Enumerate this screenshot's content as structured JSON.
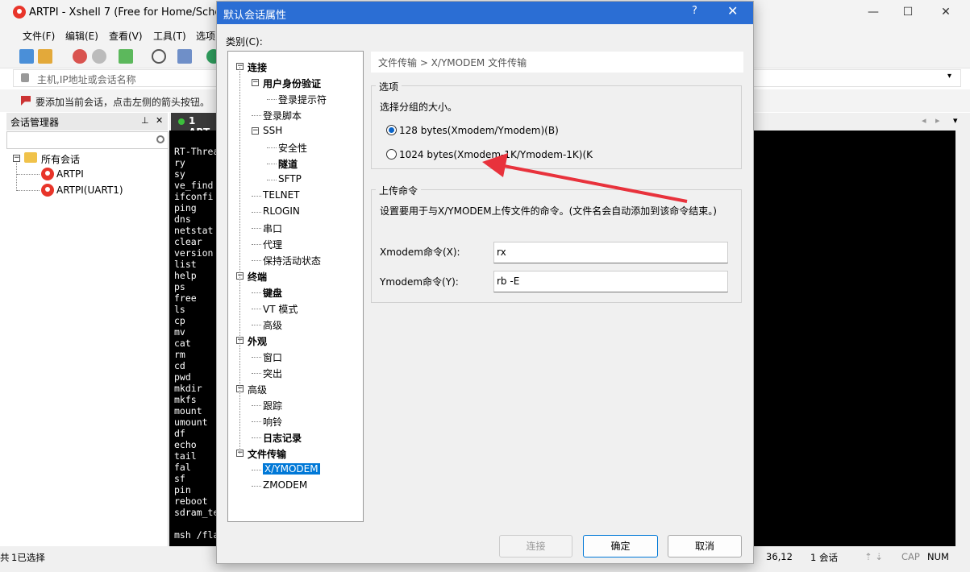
{
  "app": {
    "title": "ARTPI - Xshell 7 (Free for Home/School)"
  },
  "window_controls": {
    "minimize": "—",
    "maximize": "☐",
    "close": "✕"
  },
  "menubar": [
    {
      "label": "文件(F)"
    },
    {
      "label": "编辑(E)"
    },
    {
      "label": "查看(V)"
    },
    {
      "label": "工具(T)"
    },
    {
      "label": "选项"
    }
  ],
  "address": {
    "placeholder": "主机,IP地址或会话名称"
  },
  "tip": {
    "text": "要添加当前会话，点击左侧的箭头按钮。"
  },
  "session_manager": {
    "title": "会话管理器",
    "pin": "⊥",
    "close": "✕",
    "root": "所有会话",
    "items": [
      "ARTPI",
      "ARTPI(UART1)"
    ]
  },
  "terminal": {
    "tab_label": "1 ART",
    "lines": [
      "RT-Threa",
      "ry",
      "sy",
      "ve_find",
      "ifconfi",
      "ping",
      "dns",
      "netstat",
      "clear",
      "version",
      "list",
      "help",
      "ps",
      "free",
      "ls",
      "cp",
      "mv",
      "cat",
      "rm",
      "cd",
      "pwd",
      "mkdir",
      "mkfs",
      "mount",
      "umount",
      "df",
      "echo",
      "tail",
      "fal",
      "sf",
      "pin",
      "reboot",
      "sdram_te",
      "",
      "msh /fla"
    ]
  },
  "status": {
    "left_prefix": "共",
    "selected": "1已选择",
    "pos": "36,12",
    "sessions": "1 会话",
    "caps": "CAP",
    "num": "NUM"
  },
  "dialog": {
    "title": "默认会话属性",
    "help": "?",
    "close": "✕",
    "category_label": "类别(C):",
    "tree": [
      {
        "label": "连接",
        "level": 0,
        "bold": true,
        "toggle": "−"
      },
      {
        "label": "用户身份验证",
        "level": 1,
        "bold": true,
        "toggle": "−"
      },
      {
        "label": "登录提示符",
        "level": 2,
        "bold": false
      },
      {
        "label": "登录脚本",
        "level": 1,
        "bold": false
      },
      {
        "label": "SSH",
        "level": 1,
        "bold": false,
        "toggle": "−"
      },
      {
        "label": "安全性",
        "level": 2,
        "bold": false
      },
      {
        "label": "隧道",
        "level": 2,
        "bold": true
      },
      {
        "label": "SFTP",
        "level": 2,
        "bold": false
      },
      {
        "label": "TELNET",
        "level": 1,
        "bold": false
      },
      {
        "label": "RLOGIN",
        "level": 1,
        "bold": false
      },
      {
        "label": "串口",
        "level": 1,
        "bold": false
      },
      {
        "label": "代理",
        "level": 1,
        "bold": false
      },
      {
        "label": "保持活动状态",
        "level": 1,
        "bold": false
      },
      {
        "label": "终端",
        "level": 0,
        "bold": true,
        "toggle": "−"
      },
      {
        "label": "键盘",
        "level": 1,
        "bold": true
      },
      {
        "label": "VT 模式",
        "level": 1,
        "bold": false
      },
      {
        "label": "高级",
        "level": 1,
        "bold": false
      },
      {
        "label": "外观",
        "level": 0,
        "bold": true,
        "toggle": "−"
      },
      {
        "label": "窗口",
        "level": 1,
        "bold": false
      },
      {
        "label": "突出",
        "level": 1,
        "bold": false
      },
      {
        "label": "高级",
        "level": 0,
        "bold": false,
        "toggle": "−"
      },
      {
        "label": "跟踪",
        "level": 1,
        "bold": false
      },
      {
        "label": "响铃",
        "level": 1,
        "bold": false
      },
      {
        "label": "日志记录",
        "level": 1,
        "bold": true
      },
      {
        "label": "文件传输",
        "level": 0,
        "bold": true,
        "toggle": "−"
      },
      {
        "label": "X/YMODEM",
        "level": 1,
        "bold": false,
        "selected": true
      },
      {
        "label": "ZMODEM",
        "level": 1,
        "bold": false
      }
    ],
    "breadcrumb": "文件传输 > X/YMODEM 文件传输",
    "options": {
      "legend": "选项",
      "desc": "选择分组的大小。",
      "radio1": "128 bytes(Xmodem/Ymodem)(B)",
      "radio2": "1024 bytes(Xmodem-1K/Ymodem-1K)(K",
      "selected": 1
    },
    "upload": {
      "legend": "上传命令",
      "desc": "设置要用于与X/YMODEM上传文件的命令。(文件名会自动添加到该命令结束。)",
      "xmodem_label": "Xmodem命令(X):",
      "xmodem_value": "rx",
      "ymodem_label": "Ymodem命令(Y):",
      "ymodem_value": "rb -E"
    },
    "buttons": {
      "connect": "连接",
      "ok": "确定",
      "cancel": "取消"
    }
  },
  "colors": {
    "dialog_title_bg": "#2b6ed4",
    "selection": "#0078d7",
    "annotation_arrow": "#e8323c",
    "logo": "#e8352a"
  }
}
